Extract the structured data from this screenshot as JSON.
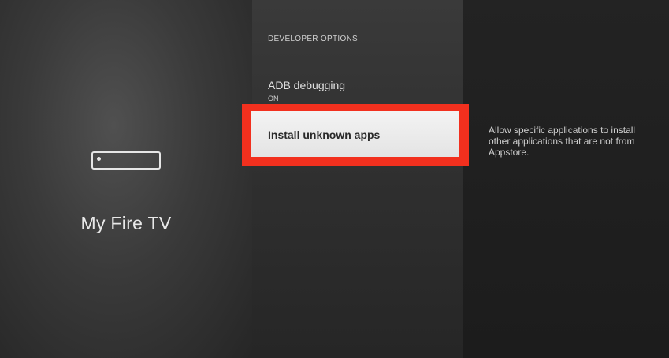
{
  "device": {
    "name": "My Fire TV",
    "icon": "fire-tv-device-icon"
  },
  "menu": {
    "section_header": "DEVELOPER OPTIONS",
    "items": [
      {
        "label": "ADB debugging",
        "value": "ON"
      },
      {
        "label": "Install unknown apps",
        "selected": true
      }
    ]
  },
  "description": "Allow specific applications to install other applications that are not from Appstore.",
  "colors": {
    "highlight": "#f2301e",
    "selected_bg": "#ececec",
    "text_light": "#e0e0e0"
  }
}
